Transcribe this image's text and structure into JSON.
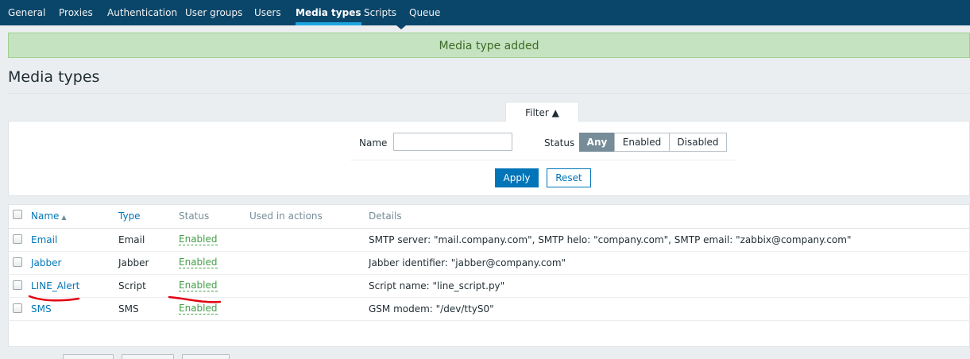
{
  "nav": {
    "items": [
      "General",
      "Proxies",
      "Authentication",
      "User groups",
      "Users",
      "Media types",
      "Scripts",
      "Queue"
    ],
    "active": "Media types"
  },
  "message": "Media type added",
  "page_title": "Media types",
  "filter": {
    "tab_label": "Filter ▲",
    "name_label": "Name",
    "name_value": "",
    "status_label": "Status",
    "status_options": [
      "Any",
      "Enabled",
      "Disabled"
    ],
    "status_selected": "Any",
    "apply_label": "Apply",
    "reset_label": "Reset"
  },
  "table": {
    "columns": [
      "Name",
      "Type",
      "Status",
      "Used in actions",
      "Details"
    ],
    "sort_column": "Name",
    "sort_indicator": "▲",
    "rows": [
      {
        "name": "Email",
        "type": "Email",
        "status": "Enabled",
        "used_in_actions": "",
        "details": "SMTP server: \"mail.company.com\", SMTP helo: \"company.com\", SMTP email: \"zabbix@company.com\""
      },
      {
        "name": "Jabber",
        "type": "Jabber",
        "status": "Enabled",
        "used_in_actions": "",
        "details": "Jabber identifier: \"jabber@company.com\""
      },
      {
        "name": "LINE_Alert",
        "type": "Script",
        "status": "Enabled",
        "used_in_actions": "",
        "details": "Script name: \"line_script.py\""
      },
      {
        "name": "SMS",
        "type": "SMS",
        "status": "Enabled",
        "used_in_actions": "",
        "details": "GSM modem: \"/dev/ttyS0\""
      }
    ]
  },
  "colors": {
    "nav_bg": "#0a466a",
    "nav_active_underline": "#1ea5e0",
    "success_bg": "#c5e3c0",
    "link": "#0275b8",
    "enabled": "#429e47",
    "annotation": "#e3000f"
  }
}
